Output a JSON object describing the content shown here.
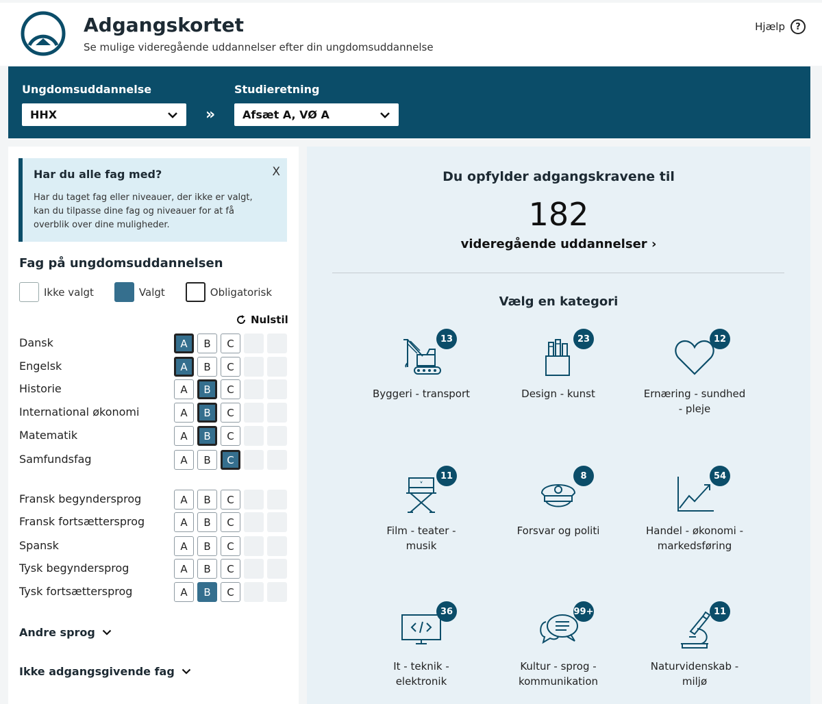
{
  "header": {
    "title": "Adgangskortet",
    "subtitle": "Se mulige videregående uddannelser efter din ungdomsuddannelse",
    "help_label": "Hjælp",
    "help_symbol": "?"
  },
  "selectors": {
    "edu_label": "Ungdomsuddannelse",
    "edu_value": "HHX",
    "arrow": "»",
    "study_label": "Studieretning",
    "study_value": "Afsæt A, VØ A"
  },
  "info": {
    "title": "Har du alle fag med?",
    "close": "X",
    "text": "Har du taget fag eller niveauer, der ikke er valgt, kan du tilpasse dine fag og niveauer for at få overblik over dine muligheder."
  },
  "subjects_section": {
    "title": "Fag på ungdomsuddannelsen",
    "legend": {
      "not_selected": "Ikke valgt",
      "selected": "Valgt",
      "mandatory": "Obligatorisk"
    },
    "reset_label": "Nulstil",
    "levels": [
      "A",
      "B",
      "C"
    ],
    "subjects": [
      {
        "name": "Dansk",
        "selected": "A",
        "mandatory": true
      },
      {
        "name": "Engelsk",
        "selected": "A",
        "mandatory": true
      },
      {
        "name": "Historie",
        "selected": "B",
        "mandatory": true
      },
      {
        "name": "International økonomi",
        "selected": "B",
        "mandatory": true
      },
      {
        "name": "Matematik",
        "selected": "B",
        "mandatory": true
      },
      {
        "name": "Samfundsfag",
        "selected": "C",
        "mandatory": true
      },
      {
        "name": "Fransk begyndersprog",
        "selected": "",
        "mandatory": false
      },
      {
        "name": "Fransk fortsættersprog",
        "selected": "",
        "mandatory": false
      },
      {
        "name": "Spansk",
        "selected": "",
        "mandatory": false
      },
      {
        "name": "Tysk begyndersprog",
        "selected": "",
        "mandatory": false
      },
      {
        "name": "Tysk fortsættersprog",
        "selected": "B",
        "mandatory": false
      }
    ],
    "other_languages": "Andre sprog",
    "non_admission": "Ikke adgangsgivende fag"
  },
  "result": {
    "heading": "Du opfylder adgangskravene til",
    "count": "182",
    "link": "videregående uddannelser",
    "category_title": "Vælg en kategori"
  },
  "categories": [
    {
      "icon": "crane-icon",
      "badge": "13",
      "line1": "Byggeri - transport",
      "line2": ""
    },
    {
      "icon": "pencil-cup-icon",
      "badge": "23",
      "line1": "Design - kunst",
      "line2": ""
    },
    {
      "icon": "heart-icon",
      "badge": "12",
      "line1": "Ernæring - sundhed",
      "line2": "- pleje"
    },
    {
      "icon": "director-chair-icon",
      "badge": "11",
      "line1": "Film - teater -",
      "line2": "musik"
    },
    {
      "icon": "police-cap-icon",
      "badge": "8",
      "line1": "Forsvar og politi",
      "line2": ""
    },
    {
      "icon": "growth-chart-icon",
      "badge": "54",
      "line1": "Handel - økonomi -",
      "line2": "markedsføring"
    },
    {
      "icon": "code-monitor-icon",
      "badge": "36",
      "line1": "It - teknik -",
      "line2": "elektronik"
    },
    {
      "icon": "speech-bubbles-icon",
      "badge": "99+",
      "line1": "Kultur - sprog -",
      "line2": "kommunikation"
    },
    {
      "icon": "microscope-icon",
      "badge": "11",
      "line1": "Naturvidenskab -",
      "line2": "miljø"
    }
  ],
  "colors": {
    "brand": "#0b4d69",
    "selected": "#356f8e",
    "panel_right": "#e8f1f6",
    "info_bg": "#dceef5"
  }
}
